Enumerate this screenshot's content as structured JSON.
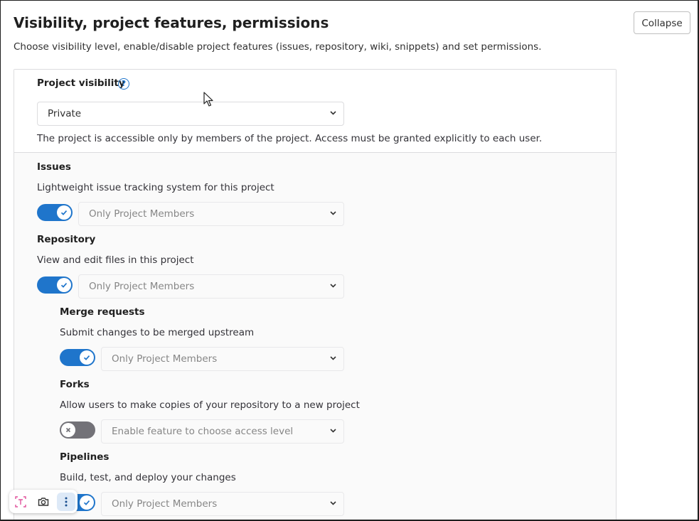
{
  "header": {
    "title": "Visibility, project features, permissions",
    "subtitle": "Choose visibility level, enable/disable project features (issues, repository, wiki, snippets) and set permissions.",
    "collapse_label": "Collapse"
  },
  "visibility": {
    "label": "Project visibility",
    "help_glyph": "?",
    "selected": "Private",
    "description": "The project is accessible only by members of the project. Access must be granted explicitly to each user."
  },
  "features": [
    {
      "title": "Issues",
      "description": "Lightweight issue tracking system for this project",
      "enabled": true,
      "access": "Only Project Members"
    },
    {
      "title": "Repository",
      "description": "View and edit files in this project",
      "enabled": true,
      "access": "Only Project Members"
    },
    {
      "title": "Merge requests",
      "description": "Submit changes to be merged upstream",
      "enabled": true,
      "access": "Only Project Members"
    },
    {
      "title": "Forks",
      "description": "Allow users to make copies of your repository to a new project",
      "enabled": false,
      "access": "Enable feature to choose access level"
    },
    {
      "title": "Pipelines",
      "description": "Build, test, and deploy your changes",
      "enabled": true,
      "access": "Only Project Members"
    }
  ],
  "toolbar": {
    "icons": [
      "text-select-icon",
      "camera-icon",
      "more-vertical-icon"
    ]
  },
  "colors": {
    "accent": "#1f75cb",
    "toggle_off": "#737278"
  }
}
